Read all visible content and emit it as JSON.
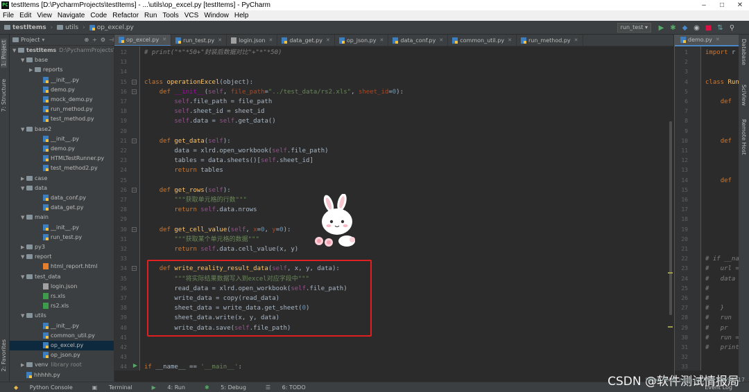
{
  "window": {
    "title": "testItems [D:\\PycharmProjects\\testItems] - ...\\utils\\op_excel.py [testItems] - PyCharm",
    "controls": [
      "–",
      "□",
      "✕"
    ]
  },
  "menu": [
    "File",
    "Edit",
    "View",
    "Navigate",
    "Code",
    "Refactor",
    "Run",
    "Tools",
    "VCS",
    "Window",
    "Help"
  ],
  "breadcrumb": [
    "testItems",
    "utils",
    "op_excel.py"
  ],
  "run_config": "run_test ▾",
  "project_panel": {
    "title": "Project",
    "tree": [
      {
        "label": "testItems",
        "extra": "D:\\PycharmProjects\\testItems",
        "indent": 0,
        "type": "folder",
        "open": true,
        "bold": true
      },
      {
        "label": "base",
        "indent": 1,
        "type": "folder",
        "open": true
      },
      {
        "label": "reports",
        "indent": 2,
        "type": "folder",
        "open": false
      },
      {
        "label": "__init__.py",
        "indent": 3,
        "type": "py"
      },
      {
        "label": "demo.py",
        "indent": 3,
        "type": "py"
      },
      {
        "label": "mock_demo.py",
        "indent": 3,
        "type": "py"
      },
      {
        "label": "run_method.py",
        "indent": 3,
        "type": "py"
      },
      {
        "label": "test_method.py",
        "indent": 3,
        "type": "py"
      },
      {
        "label": "base2",
        "indent": 1,
        "type": "folder",
        "open": true
      },
      {
        "label": "__init__.py",
        "indent": 3,
        "type": "py"
      },
      {
        "label": "demo.py",
        "indent": 3,
        "type": "py"
      },
      {
        "label": "HTMLTestRunner.py",
        "indent": 3,
        "type": "py"
      },
      {
        "label": "test_method2.py",
        "indent": 3,
        "type": "py"
      },
      {
        "label": "case",
        "indent": 1,
        "type": "folder",
        "open": false
      },
      {
        "label": "data",
        "indent": 1,
        "type": "folder",
        "open": true
      },
      {
        "label": "data_conf.py",
        "indent": 3,
        "type": "py"
      },
      {
        "label": "data_get.py",
        "indent": 3,
        "type": "py"
      },
      {
        "label": "main",
        "indent": 1,
        "type": "folder",
        "open": true
      },
      {
        "label": "__init__.py",
        "indent": 3,
        "type": "py"
      },
      {
        "label": "run_test.py",
        "indent": 3,
        "type": "py"
      },
      {
        "label": "py3",
        "indent": 1,
        "type": "folder",
        "open": false
      },
      {
        "label": "report",
        "indent": 1,
        "type": "folder",
        "open": true
      },
      {
        "label": "html_report.html",
        "indent": 3,
        "type": "html"
      },
      {
        "label": "test_data",
        "indent": 1,
        "type": "folder",
        "open": true
      },
      {
        "label": "login.json",
        "indent": 3,
        "type": "json"
      },
      {
        "label": "rs.xls",
        "indent": 3,
        "type": "xls"
      },
      {
        "label": "rs2.xls",
        "indent": 3,
        "type": "xls"
      },
      {
        "label": "utils",
        "indent": 1,
        "type": "folder",
        "open": true
      },
      {
        "label": "__init__.py",
        "indent": 3,
        "type": "py"
      },
      {
        "label": "common_util.py",
        "indent": 3,
        "type": "py"
      },
      {
        "label": "op_excel.py",
        "indent": 3,
        "type": "py",
        "selected": true
      },
      {
        "label": "op_json.py",
        "indent": 3,
        "type": "py"
      },
      {
        "label": "venv",
        "extra": "library root",
        "indent": 1,
        "type": "folder",
        "open": false
      },
      {
        "label": "hhhhh.py",
        "indent": 1,
        "type": "py"
      }
    ]
  },
  "left_tabs": [
    "1: Project",
    "7: Structure",
    "2: Favorites"
  ],
  "right_tabs": [
    "Database",
    "SciView",
    "Remote Host"
  ],
  "editor_tabs": [
    {
      "label": "op_excel.py",
      "active": true
    },
    {
      "label": "run_test.py"
    },
    {
      "label": "login.json"
    },
    {
      "label": "data_get.py"
    },
    {
      "label": "op_json.py"
    },
    {
      "label": "data_conf.py"
    },
    {
      "label": "common_util.py"
    },
    {
      "label": "run_method.py"
    }
  ],
  "line_numbers": [
    12,
    13,
    14,
    15,
    16,
    17,
    18,
    19,
    20,
    21,
    22,
    23,
    24,
    25,
    26,
    27,
    28,
    29,
    30,
    31,
    32,
    33,
    34,
    35,
    36,
    37,
    38,
    39,
    40,
    41,
    42,
    43,
    44
  ],
  "code_lines": [
    [
      [
        "cm",
        "# print(\"*\"*50+\"封装后数据对比\"+\"*\"*50)"
      ]
    ],
    [],
    [],
    [
      [
        "kw",
        "class "
      ],
      [
        "fn",
        "operationExcel"
      ],
      [
        "",
        "(object):"
      ]
    ],
    [
      [
        "",
        "    "
      ],
      [
        "kw",
        "def "
      ],
      [
        "mg",
        "__init__"
      ],
      [
        "",
        "("
      ],
      [
        "sf",
        "self"
      ],
      [
        "",
        ", "
      ],
      [
        "pa",
        "file_path"
      ],
      [
        "",
        "="
      ],
      [
        "st",
        "\"../test_data/rs2.xls\""
      ],
      [
        "",
        ", "
      ],
      [
        "pa",
        "sheet_id"
      ],
      [
        "",
        "="
      ],
      [
        "nm",
        "0"
      ],
      [
        "",
        "):"
      ]
    ],
    [
      [
        "",
        "        "
      ],
      [
        "sf",
        "self"
      ],
      [
        "",
        ".file_path = file_path"
      ]
    ],
    [
      [
        "",
        "        "
      ],
      [
        "sf",
        "self"
      ],
      [
        "",
        ".sheet_id = sheet_id"
      ]
    ],
    [
      [
        "",
        "        "
      ],
      [
        "sf",
        "self"
      ],
      [
        "",
        ".data = "
      ],
      [
        "sf",
        "self"
      ],
      [
        "",
        ".get_data()"
      ]
    ],
    [],
    [
      [
        "",
        "    "
      ],
      [
        "kw",
        "def "
      ],
      [
        "fn",
        "get_data"
      ],
      [
        "",
        "("
      ],
      [
        "sf",
        "self"
      ],
      [
        "",
        "):"
      ]
    ],
    [
      [
        "",
        "        data = xlrd.open_workbook("
      ],
      [
        "sf",
        "self"
      ],
      [
        "",
        ".file_path)"
      ]
    ],
    [
      [
        "",
        "        tables = data.sheets()["
      ],
      [
        "sf",
        "self"
      ],
      [
        "",
        ".sheet_id]"
      ]
    ],
    [
      [
        "",
        "        "
      ],
      [
        "kw",
        "return "
      ],
      [
        "",
        "tables"
      ]
    ],
    [],
    [
      [
        "",
        "    "
      ],
      [
        "kw",
        "def "
      ],
      [
        "fn",
        "get_rows"
      ],
      [
        "",
        "("
      ],
      [
        "sf",
        "self"
      ],
      [
        "",
        "):"
      ]
    ],
    [
      [
        "",
        "        "
      ],
      [
        "st",
        "\"\"\"获取单元格的行数\"\"\""
      ]
    ],
    [
      [
        "",
        "        "
      ],
      [
        "kw",
        "return "
      ],
      [
        "sf",
        "self"
      ],
      [
        "",
        ".data.nrows"
      ]
    ],
    [],
    [
      [
        "",
        "    "
      ],
      [
        "kw",
        "def "
      ],
      [
        "fn",
        "get_cell_value"
      ],
      [
        "",
        "("
      ],
      [
        "sf",
        "self"
      ],
      [
        "",
        ", "
      ],
      [
        "pa",
        "x"
      ],
      [
        "",
        "="
      ],
      [
        "nm",
        "0"
      ],
      [
        "",
        ", "
      ],
      [
        "pa",
        "y"
      ],
      [
        "",
        "="
      ],
      [
        "nm",
        "0"
      ],
      [
        "",
        "):"
      ]
    ],
    [
      [
        "",
        "        "
      ],
      [
        "st",
        "\"\"\"获取某个单元格的数据\"\"\""
      ]
    ],
    [
      [
        "",
        "        "
      ],
      [
        "kw",
        "return "
      ],
      [
        "sf",
        "self"
      ],
      [
        "",
        ".data.cell_value(x, y)"
      ]
    ],
    [],
    [
      [
        "",
        "    "
      ],
      [
        "kw",
        "def "
      ],
      [
        "fn",
        "write_reality_result_data"
      ],
      [
        "",
        "("
      ],
      [
        "sf",
        "self"
      ],
      [
        "",
        ", x, y, data):"
      ]
    ],
    [
      [
        "",
        "        "
      ],
      [
        "st",
        "\"\"\"将实际结果数据写入到excel对应字段中\"\"\""
      ]
    ],
    [
      [
        "",
        "        read_data = xlrd.open_workbook("
      ],
      [
        "sf",
        "self"
      ],
      [
        "",
        ".file_path)"
      ]
    ],
    [
      [
        "",
        "        write_data = copy(read_data)"
      ]
    ],
    [
      [
        "",
        "        sheet_data = write_data.get_sheet("
      ],
      [
        "nm",
        "0"
      ],
      [
        "",
        ")"
      ]
    ],
    [
      [
        "",
        "        sheet_data.write(x, y, data)"
      ]
    ],
    [
      [
        "",
        "        write_data.save("
      ],
      [
        "sf",
        "self"
      ],
      [
        "",
        ".file_path)"
      ]
    ],
    [],
    [],
    [],
    [
      [
        "kw",
        "if "
      ],
      [
        "",
        "__name__ == "
      ],
      [
        "st",
        "'__main__'"
      ],
      [
        "",
        ":"
      ]
    ]
  ],
  "right_editor": {
    "tab": "demo.py",
    "line_numbers": [
      1,
      2,
      3,
      4,
      5,
      6,
      7,
      8,
      9,
      10,
      11,
      12,
      13,
      14,
      15,
      16,
      17,
      18,
      19,
      20,
      21,
      22,
      23,
      24,
      25,
      26,
      27,
      28,
      29,
      30,
      31,
      32,
      33
    ],
    "lines": [
      [
        [
          "kw",
          "import "
        ],
        [
          "",
          "r"
        ]
      ],
      [],
      [],
      [
        [
          "kw",
          "class "
        ],
        [
          "fn",
          "Run"
        ]
      ],
      [],
      [
        [
          "",
          "    "
        ],
        [
          "kw",
          "def"
        ]
      ],
      [],
      [],
      [],
      [
        [
          "",
          "    "
        ],
        [
          "kw",
          "def"
        ]
      ],
      [],
      [],
      [],
      [
        [
          "",
          "    "
        ],
        [
          "kw",
          "def"
        ]
      ],
      [],
      [],
      [],
      [],
      [],
      [],
      [],
      [
        [
          "cm",
          "# if __na"
        ]
      ],
      [
        [
          "cm",
          "#   url ="
        ]
      ],
      [
        [
          "cm",
          "#   data"
        ]
      ],
      [
        [
          "cm",
          "#"
        ]
      ],
      [
        [
          "cm",
          "#"
        ]
      ],
      [
        [
          "cm",
          "#   }"
        ]
      ],
      [
        [
          "cm",
          "#   run"
        ]
      ],
      [
        [
          "cm",
          "#   pr"
        ]
      ],
      [
        [
          "cm",
          "#   run ="
        ]
      ],
      [
        [
          "cm",
          "#   print"
        ]
      ],
      []
    ]
  },
  "bottom_tools": [
    "Python Console",
    "Terminal",
    "4: Run",
    "5: Debug",
    "6: TODO"
  ],
  "event_log": "Event Log",
  "watermark": "CSDN @软件测试情报局",
  "watermark_url": "https://blog.csdn.net/m0_67695717"
}
